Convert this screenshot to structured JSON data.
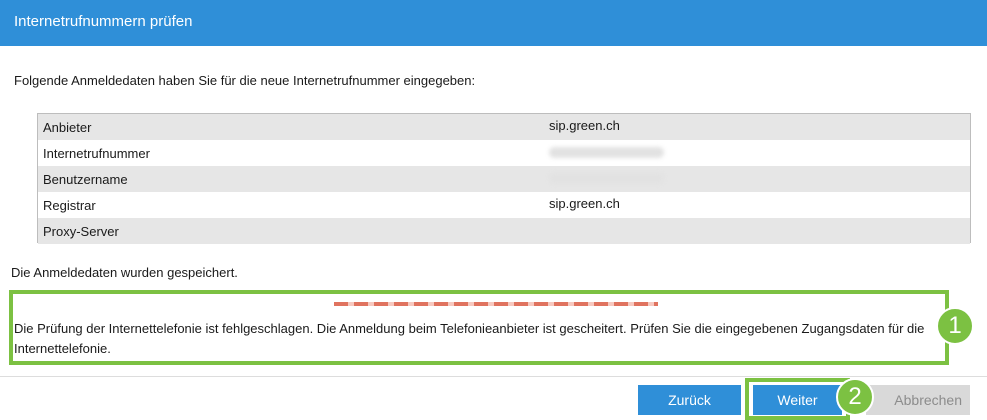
{
  "header": {
    "title": "Internetrufnummern prüfen"
  },
  "intro": "Folgende Anmeldedaten haben Sie für die neue Internetrufnummer eingegeben:",
  "table": {
    "rows": [
      {
        "label": "Anbieter",
        "value": "sip.green.ch",
        "redacted": false
      },
      {
        "label": "Internetrufnummer",
        "value": "",
        "redacted": true
      },
      {
        "label": "Benutzername",
        "value": "",
        "redacted": true
      },
      {
        "label": "Registrar",
        "value": "sip.green.ch",
        "redacted": false
      },
      {
        "label": "Proxy-Server",
        "value": "",
        "redacted": false
      }
    ]
  },
  "saved_message": "Die Anmeldedaten wurden gespeichert.",
  "error_message": "Die Prüfung der Internettelefonie ist fehlgeschlagen. Die Anmeldung beim Telefonieanbieter ist gescheitert. Prüfen Sie die eingegebenen Zugangsdaten für die Internettelefonie.",
  "annotations": {
    "badge1": "1",
    "badge2": "2"
  },
  "buttons": {
    "back": "Zurück",
    "next": "Weiter",
    "cancel": "Abbrechen"
  },
  "colors": {
    "accent": "#2f8fd8",
    "annotation_green": "#7cc142",
    "error_red": "#e0735f"
  }
}
